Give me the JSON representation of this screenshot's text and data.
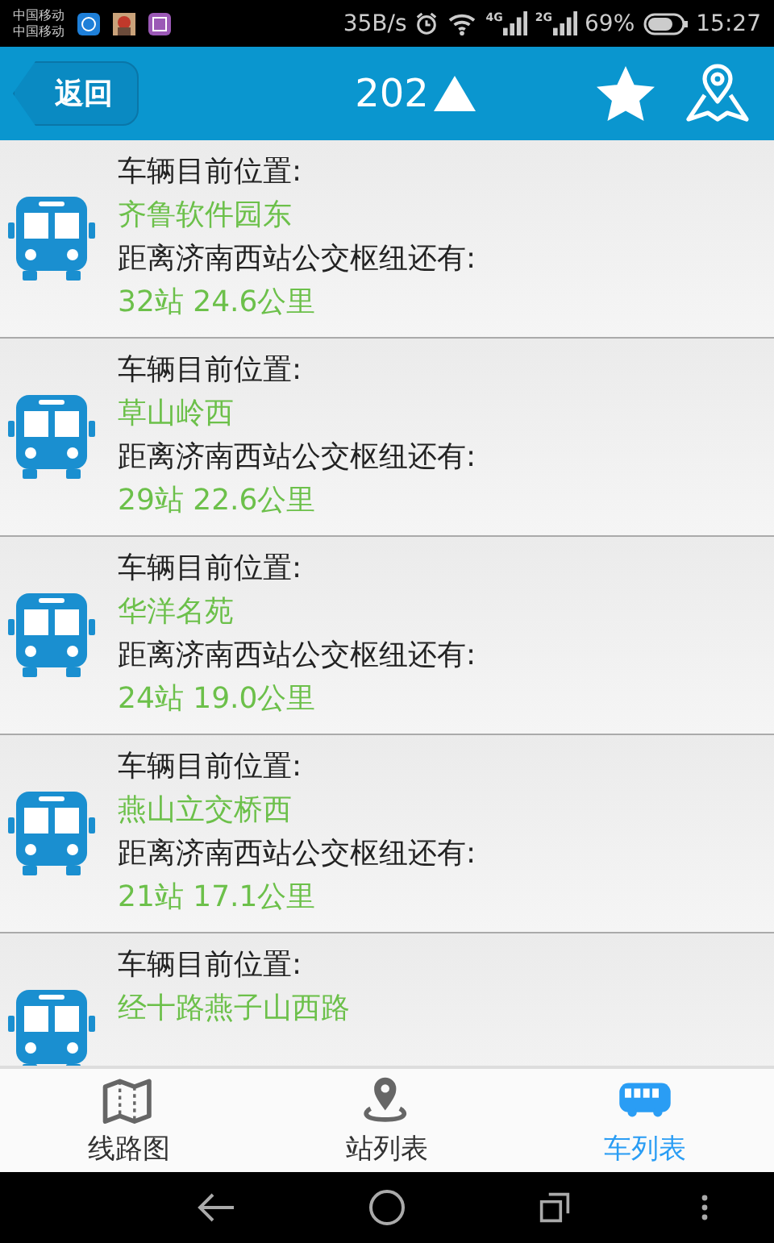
{
  "status_bar": {
    "carriers": [
      "中国移动",
      "中国移动"
    ],
    "speed": "35B/s",
    "network_1": "4G",
    "network_2": "2G",
    "battery": "69%",
    "time": "15:27"
  },
  "header": {
    "back": "返回",
    "title": "202"
  },
  "buses": [
    {
      "label": "车辆目前位置:",
      "location": "齐鲁软件园东",
      "distance_label": "距离济南西站公交枢纽还有:",
      "distance": "32站 24.6公里"
    },
    {
      "label": "车辆目前位置:",
      "location": "草山岭西",
      "distance_label": "距离济南西站公交枢纽还有:",
      "distance": "29站 22.6公里"
    },
    {
      "label": "车辆目前位置:",
      "location": "华洋名苑",
      "distance_label": "距离济南西站公交枢纽还有:",
      "distance": "24站 19.0公里"
    },
    {
      "label": "车辆目前位置:",
      "location": "燕山立交桥西",
      "distance_label": "距离济南西站公交枢纽还有:",
      "distance": "21站 17.1公里"
    },
    {
      "label": "车辆目前位置:",
      "location": "经十路燕子山西路"
    }
  ],
  "tabs": [
    {
      "label": "线路图",
      "selected": false
    },
    {
      "label": "站列表",
      "selected": false
    },
    {
      "label": "车列表",
      "selected": true
    }
  ]
}
